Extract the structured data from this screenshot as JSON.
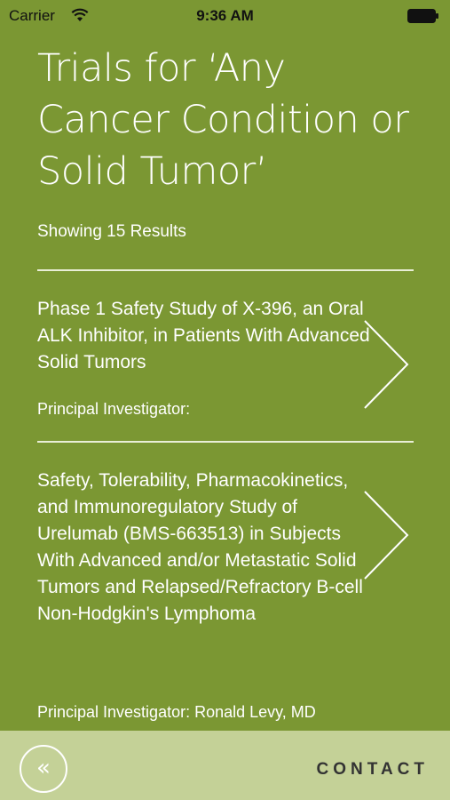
{
  "status_bar": {
    "carrier": "Carrier",
    "time": "9:36 AM"
  },
  "header": {
    "title": "Trials for ‘Any Cancer Condition or Solid Tumor’",
    "results_count": "Showing 15 Results"
  },
  "trials": [
    {
      "title": "Phase 1 Safety Study of X-396, an Oral ALK Inhibitor, in Patients With Advanced Solid Tumors",
      "principal_investigator": "Principal Investigator:"
    },
    {
      "title": "Safety, Tolerability, Pharmacokinetics, and Immunoregulatory Study of Urelumab (BMS-663513) in Subjects With Advanced and/or Metastatic Solid Tumors and Relapsed/Refractory B-cell Non-Hodgkin's Lymphoma",
      "principal_investigator": "Principal Investigator: Ronald Levy, MD"
    }
  ],
  "footer": {
    "back_icon": "«",
    "contact_label": "CONTACT"
  },
  "colors": {
    "background": "#7b9733",
    "footer_background": "#c4d197",
    "divider": "#e9eed6",
    "contact_text": "#333333"
  }
}
